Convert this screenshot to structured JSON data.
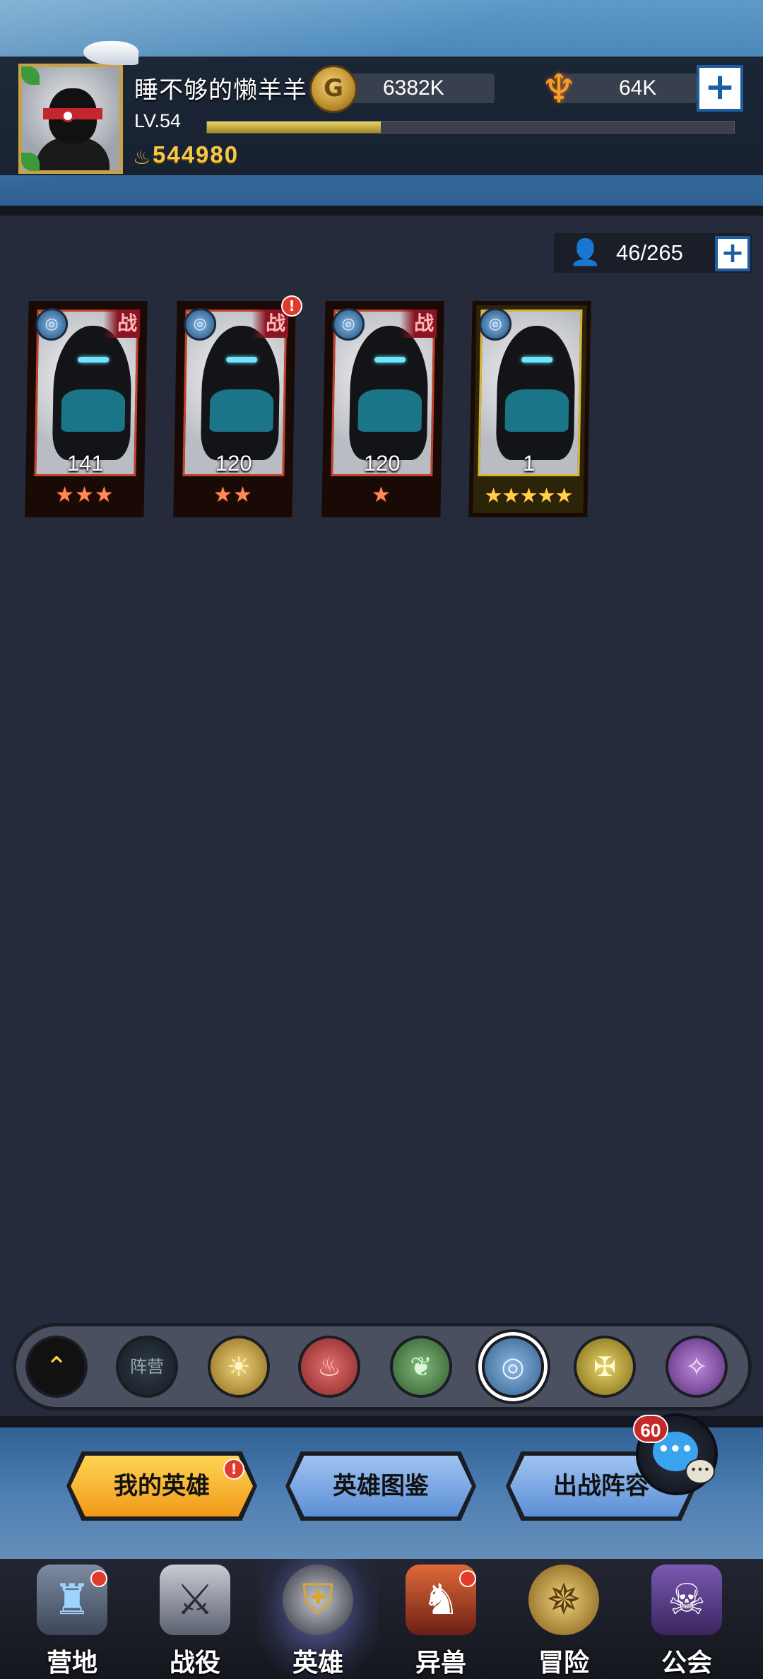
{
  "header": {
    "player_name": "睡不够的懒羊羊",
    "level": "LV.54",
    "exp_fraction": 0.33,
    "power": "544980",
    "gold": "6382K",
    "gems": "64K",
    "plus_label": "+"
  },
  "hero_count": {
    "text": "46/265",
    "plus_label": "+"
  },
  "heroes": [
    {
      "level": "141",
      "stars": "★★★",
      "battle_tag": "战",
      "alert": ""
    },
    {
      "level": "120",
      "stars": "★★",
      "battle_tag": "战",
      "alert": "!"
    },
    {
      "level": "120",
      "stars": "★",
      "battle_tag": "战",
      "alert": ""
    },
    {
      "level": "1",
      "stars": "★★★★★",
      "battle_tag": "",
      "alert": ""
    }
  ],
  "filters": {
    "all_icon": "chevron-up-icon",
    "faction_label": "阵营",
    "elements": [
      "sun-icon",
      "fire-icon",
      "leaf-icon",
      "water-icon",
      "cross-icon",
      "shadow-icon"
    ],
    "selected": "water-icon"
  },
  "tabs": {
    "my_heroes": "我的英雄",
    "my_heroes_alert": "!",
    "hero_codex": "英雄图鉴",
    "lineup": "出战阵容"
  },
  "chat": {
    "count": "60",
    "dots": "•••",
    "small_dots": "•••"
  },
  "nav": [
    {
      "label": "营地",
      "icon": "camp-icon",
      "dot": true
    },
    {
      "label": "战役",
      "icon": "crossed-swords-icon",
      "dot": false
    },
    {
      "label": "英雄",
      "icon": "knight-helmet-icon",
      "dot": false,
      "active": true
    },
    {
      "label": "异兽",
      "icon": "beast-icon",
      "dot": true
    },
    {
      "label": "冒险",
      "icon": "compass-icon",
      "dot": false
    },
    {
      "label": "公会",
      "icon": "guild-banner-icon",
      "dot": false
    }
  ],
  "colors": {
    "accent_gold": "#f5c84a",
    "tab_active": "#f09a18",
    "tab_inactive": "#5c8fd6",
    "card_red_frame": "#c2432a",
    "card_gold_frame": "#d9b43a"
  }
}
